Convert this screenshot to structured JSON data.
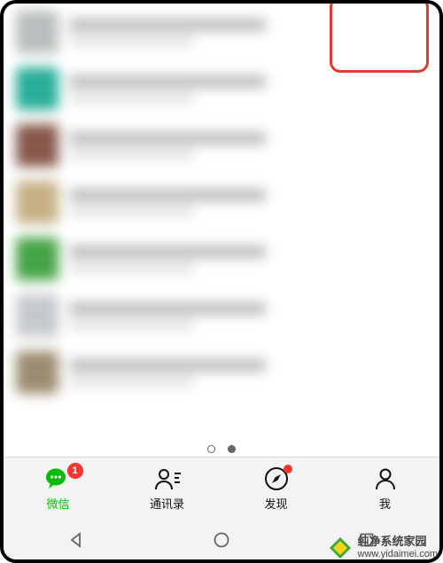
{
  "colors": {
    "accent": "#09bb07",
    "badge": "#f43530",
    "highlight": "#e03a2f"
  },
  "tabs": {
    "chats": {
      "label": "微信",
      "badge": "1"
    },
    "contacts": {
      "label": "通讯录"
    },
    "discover": {
      "label": "发现",
      "has_dot_badge": true
    },
    "me": {
      "label": "我"
    }
  },
  "sys_nav": {
    "back": "back-triangle",
    "home": "home-circle",
    "recent": "recent-square"
  },
  "watermark": {
    "title": "纯净系统家园",
    "url": "www.yidaimei.com"
  },
  "highlight_target": "me-tab",
  "blurred_chat_rows": [
    {
      "avatar_color": "#b9bebf"
    },
    {
      "avatar_color": "#17b39b"
    },
    {
      "avatar_color": "#8d5747"
    },
    {
      "avatar_color": "#c9b07e"
    },
    {
      "avatar_color": "#3aa83a"
    },
    {
      "avatar_color": "#c6c9cc"
    },
    {
      "avatar_color": "#9f8c6c"
    }
  ]
}
